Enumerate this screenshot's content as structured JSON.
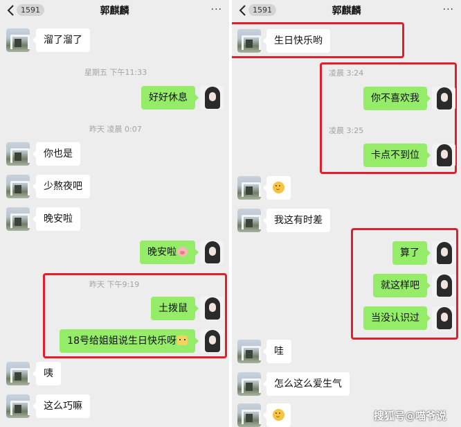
{
  "header": {
    "back_label": "1591",
    "title": "郭麒麟",
    "more": "···"
  },
  "left": {
    "messages": {
      "m1": "溜了溜了",
      "ts1": "星期五 下午11:33",
      "m2": "好好休息",
      "ts2": "昨天 凌晨 0:07",
      "m3": "你也是",
      "m4": "少熬夜吧",
      "m5": "晚安啦",
      "m6": "晚安啦",
      "ts3": "昨天 下午9:19",
      "m7": "土拨鼠",
      "m8": "18号给姐姐说生日快乐呀",
      "m9": "咦",
      "m10": "这么巧嘛"
    }
  },
  "right": {
    "messages": {
      "m1": "生日快乐哟",
      "ts1": "凌晨 3:24",
      "m2": "你不喜欢我",
      "ts2": "凌晨 3:25",
      "m3": "卡点不到位",
      "m4": "",
      "m5": "我这有时差",
      "m6": "算了",
      "m7": "就这样吧",
      "m8": "当没认识过",
      "m9": "哇",
      "m10": "怎么这么爱生气",
      "m11": ""
    }
  },
  "watermark": "搜狐号@喵爷说",
  "colors": {
    "sent_bubble": "#95ec69",
    "received_bubble": "#ffffff",
    "highlight": "#e11f2a",
    "background": "#ededed"
  },
  "icons": {
    "back": "chevron-left-icon",
    "more": "more-dots-icon",
    "emoji_smile": "smile-emoji-icon",
    "emoji_pig": "pig-emoji-icon",
    "emoji_cat": "cat-emoji-icon"
  }
}
